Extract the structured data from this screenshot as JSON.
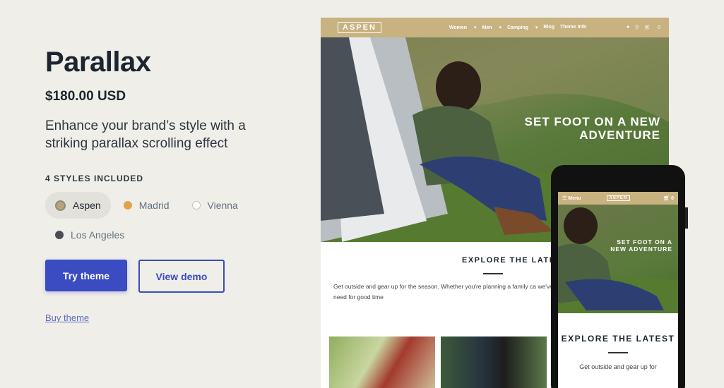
{
  "theme": {
    "name": "Parallax",
    "price": "$180.00 USD",
    "tagline": "Enhance your brand’s style with a striking parallax scrolling effect",
    "styles_label": "4 STYLES INCLUDED",
    "styles": [
      {
        "label": "Aspen",
        "color": "#b6a57c",
        "active": true
      },
      {
        "label": "Madrid",
        "color": "#e3a34a",
        "active": false
      },
      {
        "label": "Vienna",
        "color": "#ffffff",
        "active": false
      },
      {
        "label": "Los Angeles",
        "color": "#4a4d58",
        "active": false
      }
    ],
    "try_button": "Try theme",
    "demo_button": "View demo",
    "buy_link": "Buy theme"
  },
  "preview_desktop": {
    "logo": "ASPEN",
    "menu": [
      "Women",
      "Men",
      "Camping",
      "Blog",
      "Theme Info"
    ],
    "icons": [
      "user-icon",
      "search-icon",
      "cart-icon"
    ],
    "cart_count": "0",
    "hero_text": "SET FOOT ON A NEW ADVENTURE",
    "explore_title": "EXPLORE THE LATEST",
    "explore_copy": "Get outside and gear up for the season. Whether you're planning a family ca we've got you covered with everything you'll need for good time",
    "accent": "#c7b280"
  },
  "preview_mobile": {
    "menu_label": "Menu",
    "logo": "ASPEN",
    "cart_count": "0",
    "hero_text": "SET FOOT ON A NEW ADVENTURE",
    "explore_title": "EXPLORE THE LATEST",
    "explore_copy": "Get outside and gear up for"
  }
}
